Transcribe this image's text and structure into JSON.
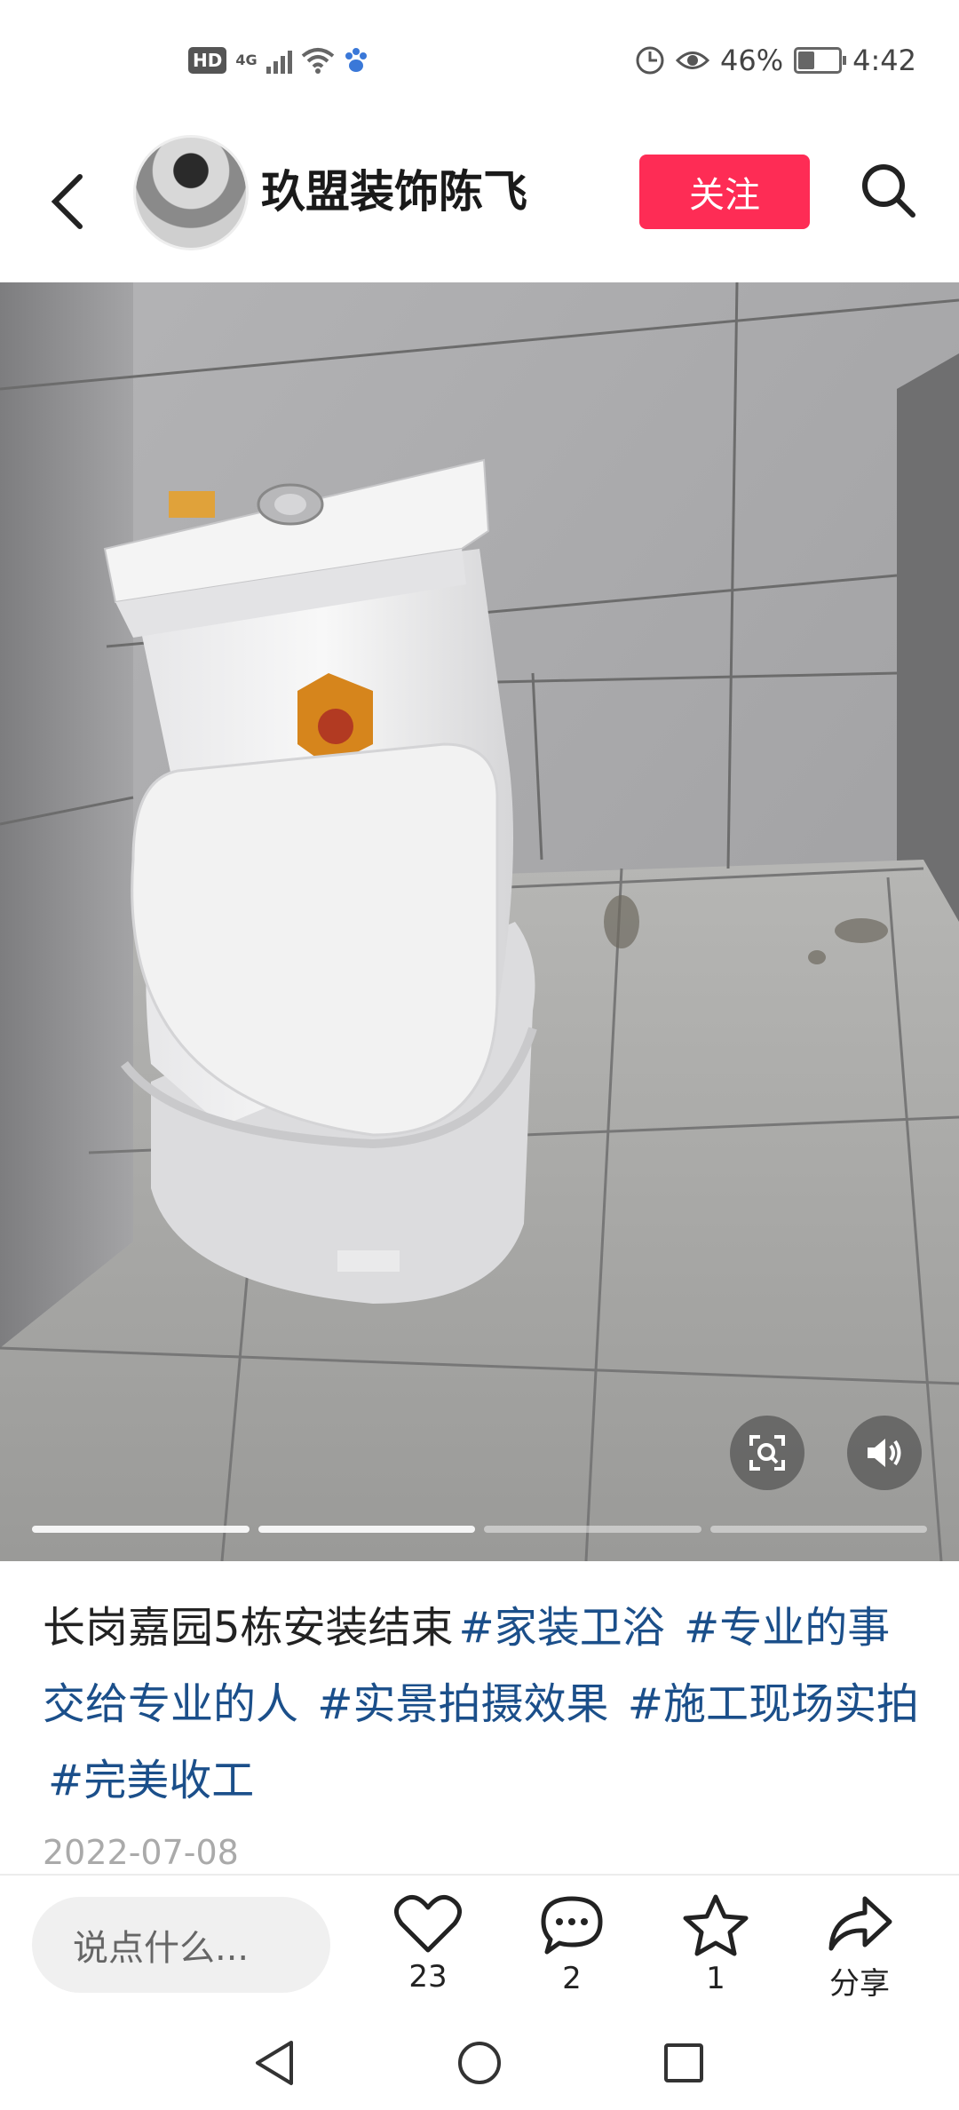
{
  "status_bar": {
    "hd": "HD",
    "network": "4G",
    "battery_text": "46%",
    "battery_level": 0.46,
    "time": "4:42"
  },
  "header": {
    "username": "玖盟装饰陈飞",
    "follow_label": "关注"
  },
  "photo": {
    "page_count": 4,
    "active_page": 2
  },
  "caption": {
    "text": "长岗嘉园5栋安装结束",
    "tags": [
      "#家装卫浴",
      "#专业的事交给专业的人",
      "#实景拍摄效果",
      "#施工现场实拍",
      "#完美收工"
    ]
  },
  "date": "2022-07-08",
  "actions": {
    "comment_placeholder": "说点什么...",
    "like_count": "23",
    "comment_count": "2",
    "favorite_count": "1",
    "share_label": "分享"
  },
  "colors": {
    "accent": "#fe2c55",
    "tag": "#1b4f8a"
  }
}
